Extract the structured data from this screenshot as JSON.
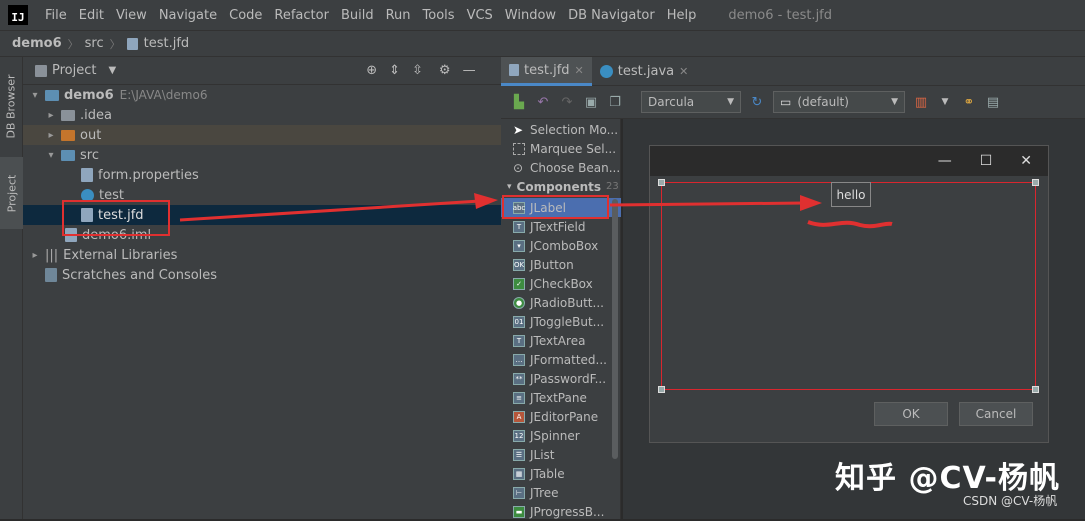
{
  "menubar": {
    "logo": "IJ",
    "items": [
      "File",
      "Edit",
      "View",
      "Navigate",
      "Code",
      "Refactor",
      "Build",
      "Run",
      "Tools",
      "VCS",
      "Window",
      "DB Navigator",
      "Help"
    ],
    "window_title": "demo6 - test.jfd"
  },
  "breadcrumb": [
    "demo6",
    "src",
    "test.jfd"
  ],
  "sidestrip": {
    "db_browser": "DB Browser",
    "project": "Project"
  },
  "project_panel": {
    "title": "Project",
    "tree": [
      {
        "label": "demo6",
        "hint": "E:\\JAVA\\demo6"
      },
      {
        "label": ".idea"
      },
      {
        "label": "out"
      },
      {
        "label": "src"
      },
      {
        "label": "form.properties"
      },
      {
        "label": "test"
      },
      {
        "label": "test.jfd"
      },
      {
        "label": "demo6.iml"
      },
      {
        "label": "External Libraries"
      },
      {
        "label": "Scratches and Consoles"
      }
    ]
  },
  "editor_tabs": [
    {
      "label": "test.jfd"
    },
    {
      "label": "test.java"
    }
  ],
  "toolbar": {
    "theme": "Darcula",
    "locale": "(default)"
  },
  "palette": {
    "tools": [
      "Selection Mo...",
      "Marquee Sel...",
      "Choose Bean..."
    ],
    "section": "Components",
    "section_count": "23",
    "components": [
      "JLabel",
      "JTextField",
      "JComboBox",
      "JButton",
      "JCheckBox",
      "JRadioButt...",
      "JToggleBut...",
      "JTextArea",
      "JFormatted...",
      "JPasswordF...",
      "JTextPane",
      "JEditorPane",
      "JSpinner",
      "JList",
      "JTable",
      "JTree",
      "JProgressB..."
    ]
  },
  "dialog": {
    "label_text": "hello",
    "ok": "OK",
    "cancel": "Cancel"
  },
  "watermark": {
    "zhihu": "知乎 @CV-杨帆",
    "csdn": "CSDN @CV-杨帆"
  },
  "colors": {
    "annotation_red": "#e03030",
    "accent_blue": "#4a88c7"
  }
}
